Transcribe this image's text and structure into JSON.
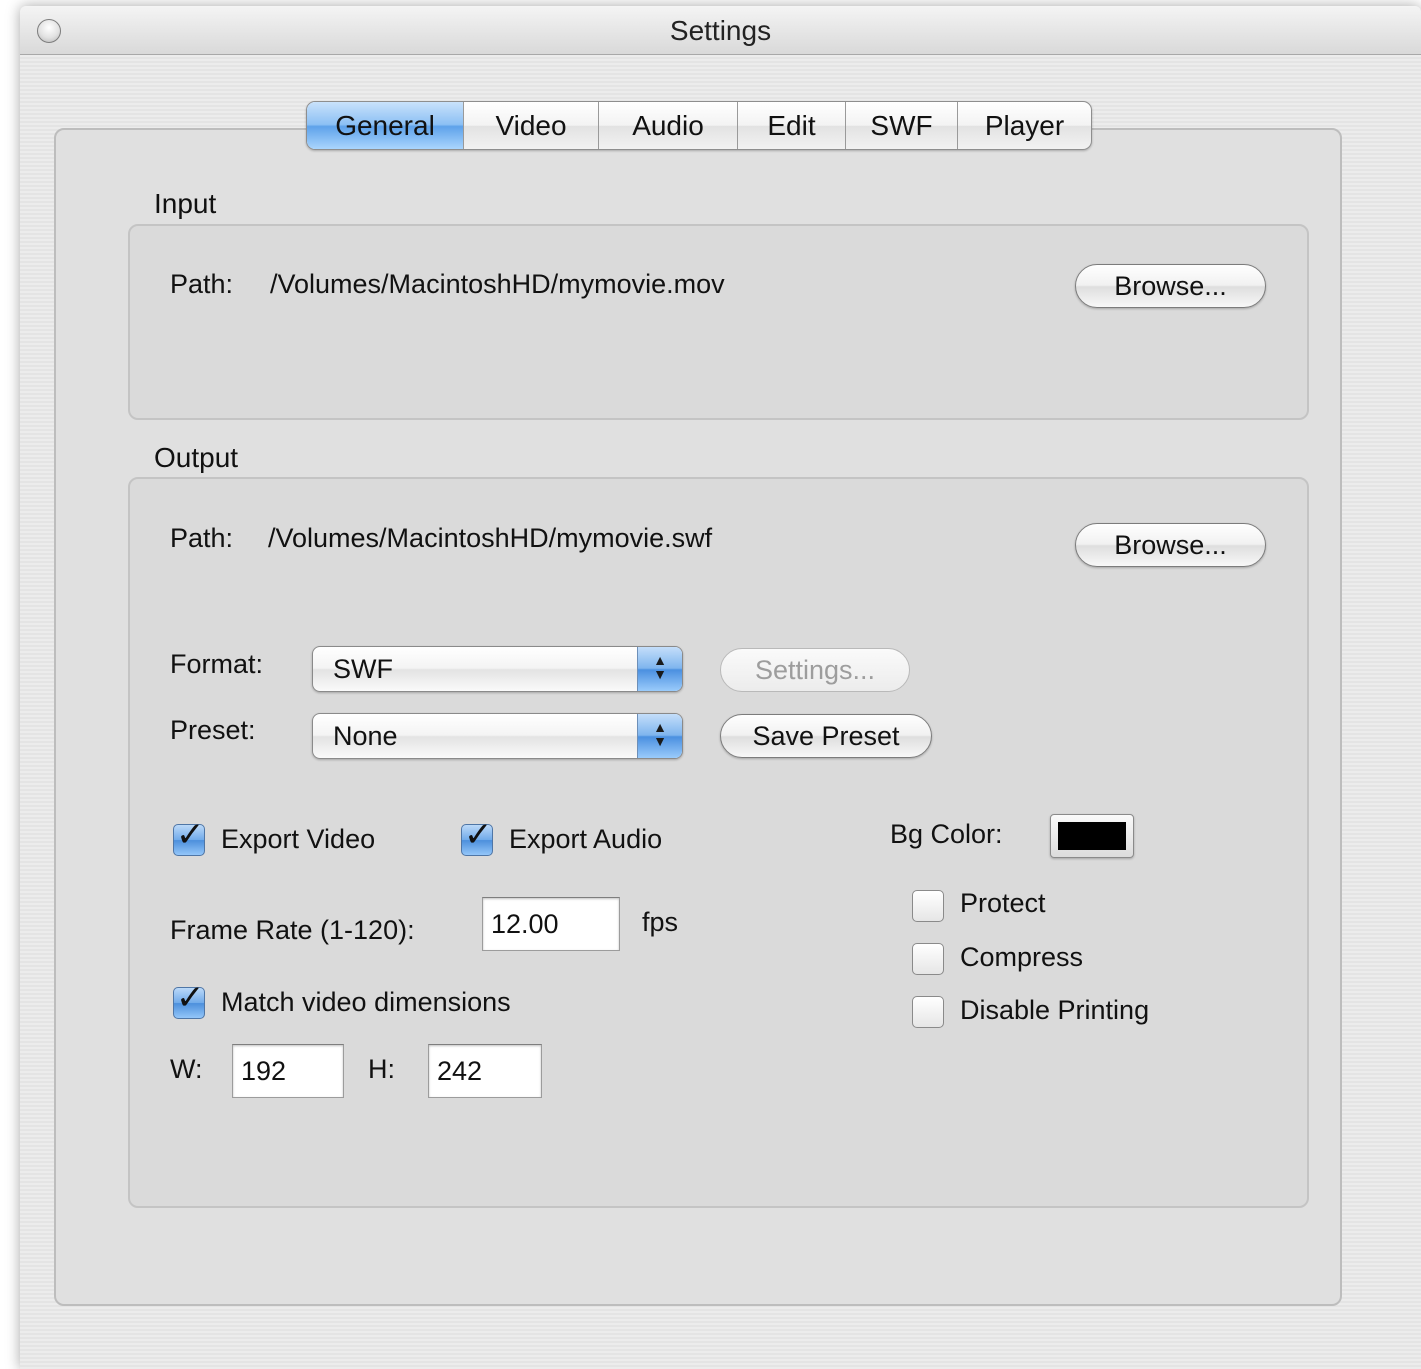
{
  "window": {
    "title": "Settings"
  },
  "tabs": [
    {
      "label": "General",
      "active": true
    },
    {
      "label": "Video",
      "active": false
    },
    {
      "label": "Audio",
      "active": false
    },
    {
      "label": "Edit",
      "active": false
    },
    {
      "label": "SWF",
      "active": false
    },
    {
      "label": "Player",
      "active": false
    }
  ],
  "input": {
    "group_label": "Input",
    "path_label": "Path:",
    "path_value": "/Volumes/MacintoshHD/mymovie.mov",
    "browse_label": "Browse..."
  },
  "output": {
    "group_label": "Output",
    "path_label": "Path:",
    "path_value": "/Volumes/MacintoshHD/mymovie.swf",
    "browse_label": "Browse...",
    "format_label": "Format:",
    "format_value": "SWF",
    "settings_label": "Settings...",
    "preset_label": "Preset:",
    "preset_value": "None",
    "save_preset_label": "Save Preset",
    "export_video": {
      "label": "Export Video",
      "checked": true
    },
    "export_audio": {
      "label": "Export Audio",
      "checked": true
    },
    "frame_rate_label": "Frame Rate (1-120):",
    "frame_rate_value": "12.00",
    "fps_label": "fps",
    "match_dims": {
      "label": "Match video dimensions",
      "checked": true
    },
    "w_label": "W:",
    "w_value": "192",
    "h_label": "H:",
    "h_value": "242",
    "bg_color_label": "Bg Color:",
    "bg_color": "#000000",
    "protect": {
      "label": "Protect",
      "checked": false
    },
    "compress": {
      "label": "Compress",
      "checked": false
    },
    "disable_printing": {
      "label": "Disable Printing",
      "checked": false
    }
  },
  "colors": {
    "accent": "#5ea2ea",
    "window_bg": "#e9e9e9"
  },
  "icons": {
    "checkmark": "checkmark-icon",
    "popup_arrows": "up-down-arrows-icon"
  }
}
